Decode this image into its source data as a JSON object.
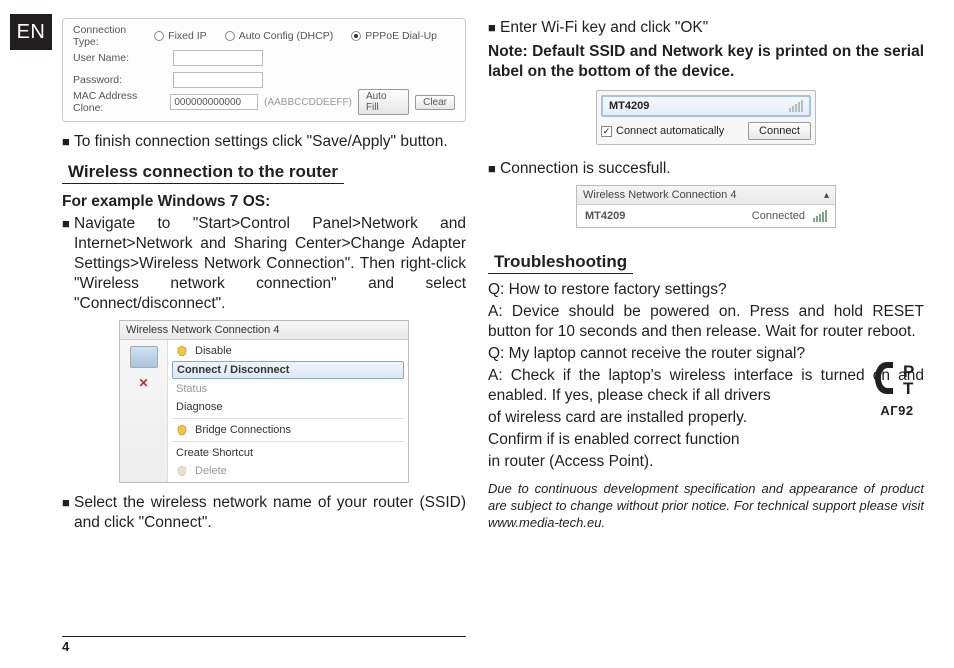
{
  "lang_tab": "EN",
  "page_number": "4",
  "conn_panel": {
    "rows": {
      "type_label": "Connection Type:",
      "fixed": "Fixed IP",
      "dhcp": "Auto Config (DHCP)",
      "pppoe": "PPPoE Dial-Up",
      "user_label": "User Name:",
      "pass_label": "Password:",
      "mac_label": "MAC Address Clone:",
      "mac_value": "000000000000",
      "mac_hint": "(AABBCCDDEEFF)",
      "autofill": "Auto Fill",
      "clear": "Clear"
    }
  },
  "left": {
    "b1": "To finish connection settings click \"Save/Apply\" button.",
    "sec1": "Wireless connection to the router",
    "example": "For example Windows 7 OS:",
    "b2": "Navigate to \"Start>Control Panel>Network and Internet>Network and Sharing Center>Change Adapter Settings>Wireless Network Connection\". Then right-click \"Wireless network connection\" and select \"Connect/disconnect\".",
    "b3": "Select the wireless network name of your router (SSID) and click \"Connect\"."
  },
  "win_menu": {
    "title": "Wireless Network Connection 4",
    "items": {
      "disable": "Disable",
      "connect": "Connect / Disconnect",
      "status": "Status",
      "diagnose": "Diagnose",
      "bridge": "Bridge Connections",
      "shortcut": "Create Shortcut",
      "delete": "Delete"
    }
  },
  "right": {
    "b1": "Enter Wi-Fi key and click \"OK\"",
    "note": "Note: Default SSID and Network key is printed on the serial label on the bottom of the device.",
    "b2": "Connection is succesfull.",
    "sec": "Troubleshooting",
    "q1": "Q: How to restore factory settings?",
    "a1": "A: Device should be powered on. Press and hold RESET button for 10 seconds and then release. Wait for router reboot.",
    "q2": "Q: My laptop cannot receive the router signal?",
    "a2a": "A: Check if the laptop's wireless interface is turned on and enabled. If yes, please check if all drivers",
    "a2b": "of wireless card are installed properly.",
    "a2c": "Confirm if is enabled correct function",
    "a2d": "in router (Access Point).",
    "footnote": "Due to continuous development specification and appearance of product are subject to change without prior notice. For technical support please visit www.media-tech.eu."
  },
  "popover": {
    "ssid": "MT4209",
    "auto": "Connect automatically",
    "btn": "Connect"
  },
  "connected": {
    "title": "Wireless Network Connection 4",
    "ssid": "MT4209",
    "status": "Connected"
  },
  "cert": {
    "glyph": "Ͼ",
    "sub": "АГ92"
  }
}
